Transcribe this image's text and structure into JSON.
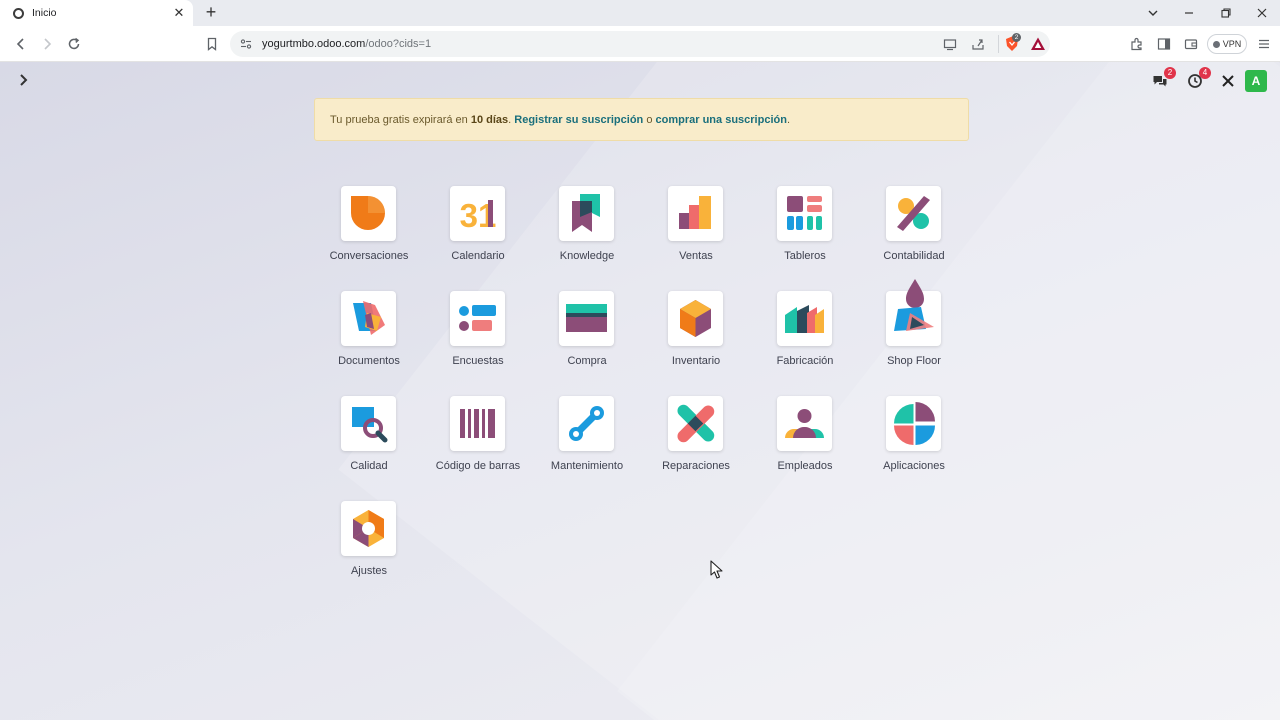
{
  "browser": {
    "tab_title": "Inicio",
    "url_host": "yogurtmbo.odoo.com",
    "url_path": "/odoo?cids=1",
    "vpn_label": "VPN",
    "brave_count": "2"
  },
  "odoo": {
    "messages_count": "2",
    "activities_count": "4",
    "avatar_letter": "A"
  },
  "banner": {
    "prefix": "Tu prueba gratis expirará en ",
    "days": "10 días",
    "sep1": ". ",
    "register_link": "Registrar su suscripción",
    "sep2": " o ",
    "buy_link": "comprar una suscripción",
    "suffix": "."
  },
  "apps": [
    {
      "label": "Conversaciones",
      "icon": "conversaciones-icon"
    },
    {
      "label": "Calendario",
      "icon": "calendario-icon"
    },
    {
      "label": "Knowledge",
      "icon": "knowledge-icon"
    },
    {
      "label": "Ventas",
      "icon": "ventas-icon"
    },
    {
      "label": "Tableros",
      "icon": "tableros-icon"
    },
    {
      "label": "Contabilidad",
      "icon": "contabilidad-icon"
    },
    {
      "label": "Documentos",
      "icon": "documentos-icon"
    },
    {
      "label": "Encuestas",
      "icon": "encuestas-icon"
    },
    {
      "label": "Compra",
      "icon": "compra-icon"
    },
    {
      "label": "Inventario",
      "icon": "inventario-icon"
    },
    {
      "label": "Fabricación",
      "icon": "fabricacion-icon"
    },
    {
      "label": "Shop Floor",
      "icon": "shop-floor-icon"
    },
    {
      "label": "Calidad",
      "icon": "calidad-icon"
    },
    {
      "label": "Código de barras",
      "icon": "codigo-barras-icon"
    },
    {
      "label": "Mantenimiento",
      "icon": "mantenimiento-icon"
    },
    {
      "label": "Reparaciones",
      "icon": "reparaciones-icon"
    },
    {
      "label": "Empleados",
      "icon": "empleados-icon"
    },
    {
      "label": "Aplicaciones",
      "icon": "aplicaciones-icon"
    },
    {
      "label": "Ajustes",
      "icon": "ajustes-icon"
    }
  ],
  "calendar_day": "31",
  "colors": {
    "orange": "#f07b18",
    "teal": "#1fc2a8",
    "purple": "#8c4d78",
    "blue": "#1b9bde",
    "pink": "#ef7d7d",
    "yellow": "#f9b23a",
    "banner_bg": "#f9ecca",
    "avatar_green": "#2eb84b"
  }
}
